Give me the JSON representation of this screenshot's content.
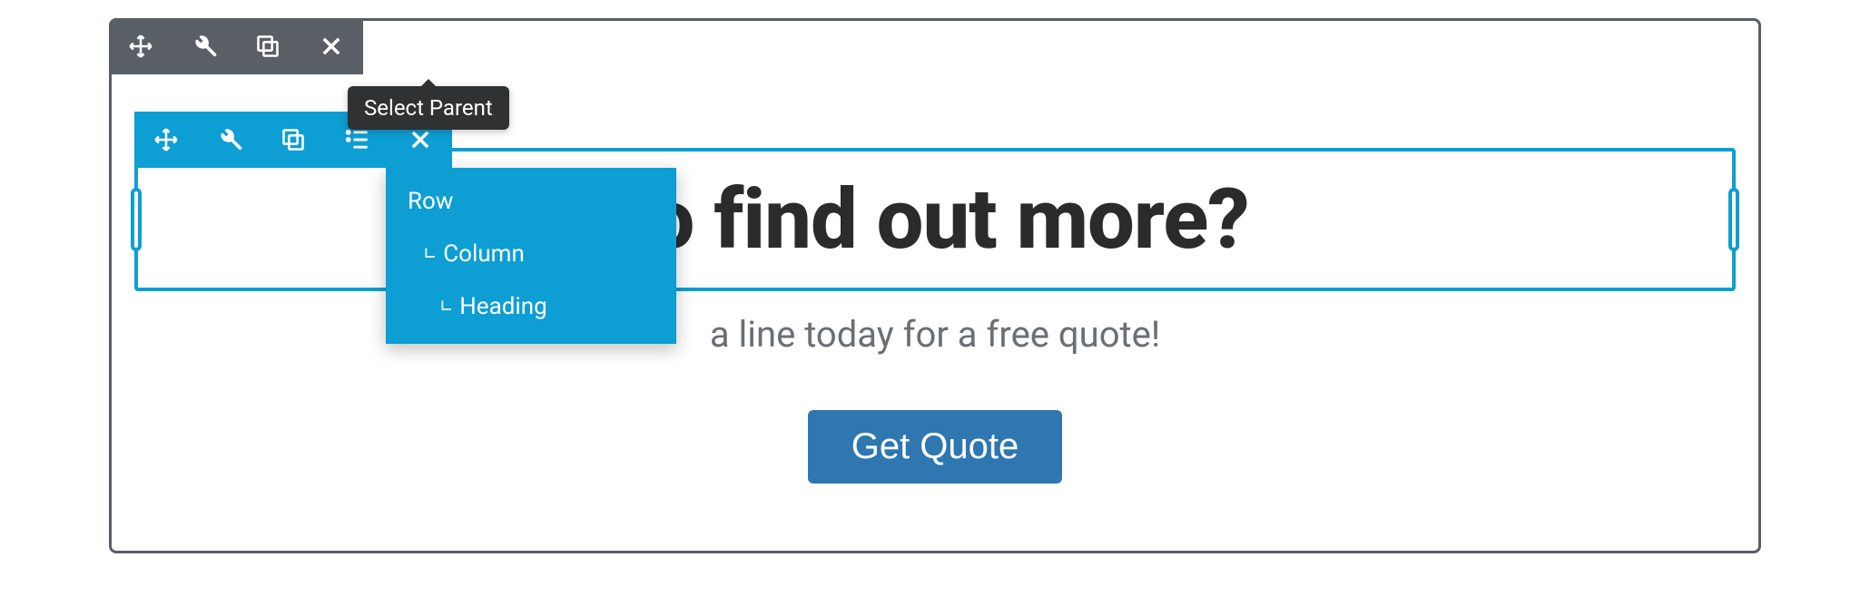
{
  "tooltip": {
    "select_parent": "Select Parent"
  },
  "dropdown": {
    "items": [
      {
        "label": "Row",
        "indent": 0
      },
      {
        "label": "Column",
        "indent": 1
      },
      {
        "label": "Heading",
        "indent": 2
      }
    ]
  },
  "content": {
    "heading_fragment": "to find out more?",
    "subheading_fragment": "a line today for a free quote!",
    "cta_label": "Get Quote"
  },
  "icons": {
    "move": "move-icon",
    "wrench": "wrench-icon",
    "duplicate": "duplicate-icon",
    "close": "close-icon",
    "tree": "tree-icon"
  },
  "colors": {
    "toolbar_dark": "#5a5f66",
    "toolbar_blue": "#0d9ed3",
    "cta": "#2e77b0",
    "text_muted": "#6a6f75"
  }
}
